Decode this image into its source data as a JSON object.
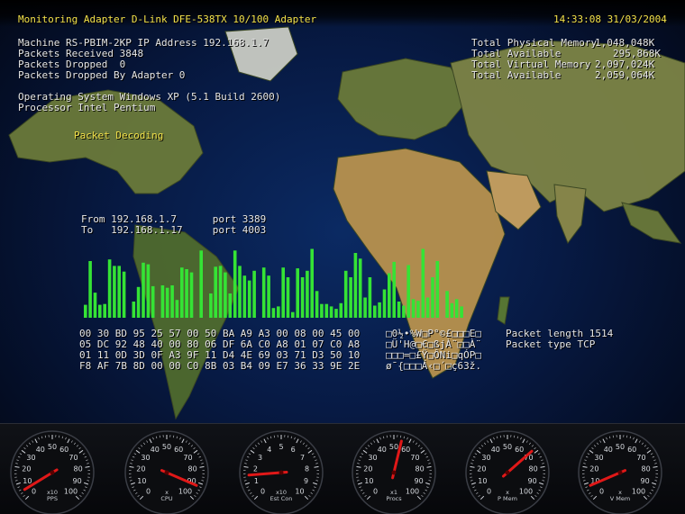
{
  "header": {
    "title": "Monitoring Adapter D-Link DFE-538TX 10/100 Adapter",
    "datetime": "14:33:08 31/03/2004"
  },
  "info_left": [
    "Machine RS-PBIM-2KP IP Address 192.168.1.7",
    "Packets Received 3848",
    "Packets Dropped  0",
    "Packets Dropped By Adapter 0"
  ],
  "system_info": [
    "Operating System Windows XP (5.1 Build 2600)",
    "Processor Intel Pentium"
  ],
  "memory": [
    {
      "label": "Total Physical Memory",
      "value": "1,048,048K"
    },
    {
      "label": "Total Available",
      "value": "295,868K"
    },
    {
      "label": "Total Virtual Memory",
      "value": "2,097,024K"
    },
    {
      "label": "Total Available",
      "value": "2,059,064K"
    }
  ],
  "packet_decoding_label": "Packet Decoding",
  "connection": {
    "from_line": "From 192.168.1.7      port 3389",
    "to_line": "To   192.168.1.17     port 4003"
  },
  "byte_activity": [
    16,
    70,
    31,
    16,
    17,
    72,
    64,
    64,
    57,
    0,
    20,
    38,
    68,
    66,
    39,
    0,
    40,
    37,
    40,
    22,
    62,
    60,
    56,
    0,
    83,
    0,
    30,
    63,
    64,
    56,
    30,
    83,
    64,
    52,
    46,
    58,
    0,
    62,
    52,
    12,
    14,
    62,
    50,
    7,
    61,
    50,
    58,
    85,
    33,
    17,
    17,
    14,
    11,
    18,
    58,
    50,
    80,
    73,
    25,
    50,
    15,
    19,
    35,
    55,
    69,
    20,
    15,
    65,
    23,
    21,
    85,
    25,
    50,
    70,
    0,
    33,
    18,
    23,
    14
  ],
  "hex_dump": [
    "00 30 BD 95 25 57 00 50 BA A9 A3 00 08 00 45 00",
    "05 DC 92 48 40 00 80 06 DF 6A C0 A8 01 07 C0 A8",
    "01 11 0D 3D 0F A3 9F 11 D4 4E 69 03 71 D3 50 10",
    "F8 AF 7B 8D 00 00 C0 8B 03 B4 09 E7 36 33 9E 2E"
  ],
  "ascii_dump": [
    "□0½•%W□P°©£□□□E□",
    "□Ü'H@□€□ßjÀ¨□□À¨",
    "□□□=□£Ÿ□ÔNi□qÓP□",
    "ø¯{□□□Á‹□´□ç63ž."
  ],
  "packet_info": {
    "length": "Packet length 1514",
    "type": "Packet type TCP"
  },
  "gauge_ticks": [
    "0",
    "10",
    "20",
    "30",
    "40",
    "50",
    "60",
    "70",
    "80",
    "90",
    "100"
  ],
  "gauges": [
    {
      "label": "PPS",
      "multiplier": "x10",
      "value": 5,
      "needle_color": "#e01818"
    },
    {
      "label": "CPU",
      "multiplier": "x",
      "value": 92,
      "needle_color": "#e01818"
    },
    {
      "label": "Est Con",
      "multiplier": "x10",
      "value": 1.5,
      "max": 10,
      "ticks": [
        "0",
        "1",
        "2",
        "3",
        "4",
        "5",
        "6",
        "7",
        "8",
        "9",
        "10"
      ],
      "needle_color": "#e01818"
    },
    {
      "label": "Procs",
      "multiplier": "x1",
      "value": 55,
      "needle_color": "#e01818"
    },
    {
      "label": "P Mem",
      "multiplier": "x",
      "value": 68,
      "needle_color": "#e01818"
    },
    {
      "label": "V Mem",
      "multiplier": "x",
      "value": 8,
      "needle_color": "#e01818"
    }
  ],
  "colors": {
    "accent_text": "#f4e24a",
    "body_text": "#e6e6e6",
    "bar_color": "#35e335",
    "ocean": "#0b2a63"
  }
}
